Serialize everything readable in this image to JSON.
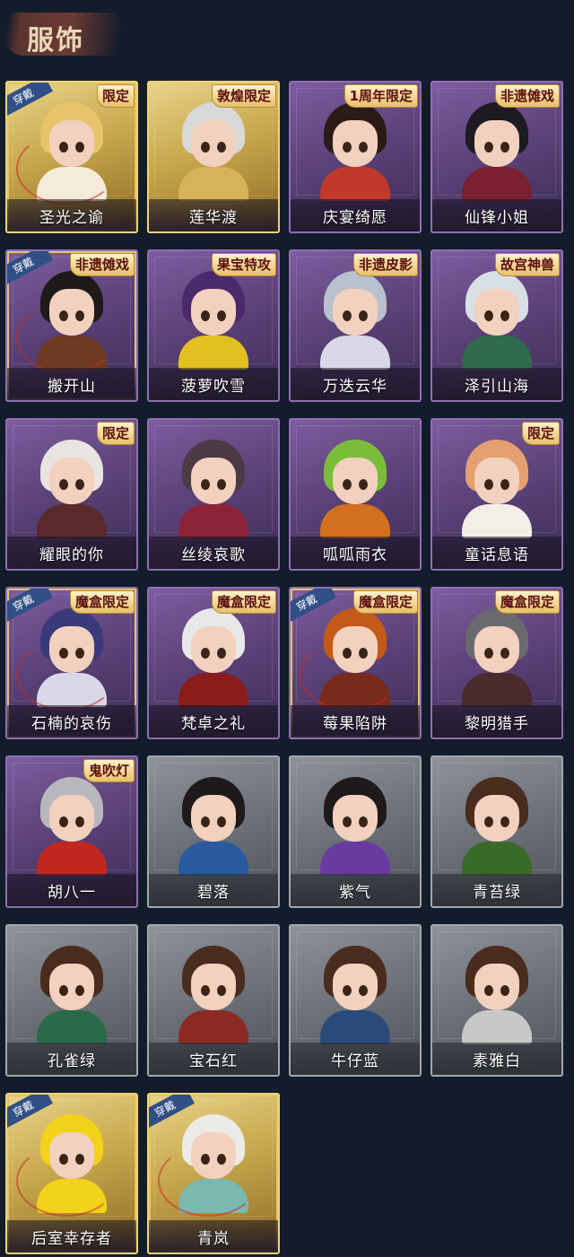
{
  "header": {
    "title": "服饰"
  },
  "cards": [
    {
      "name": "圣光之谕",
      "rarity": "gold",
      "tag": "限定",
      "equipped": true,
      "hair": "#e7c36a",
      "body": "#f4ecd8"
    },
    {
      "name": "莲华渡",
      "rarity": "gold",
      "tag": "敦煌限定",
      "equipped": false,
      "hair": "#d9d9d9",
      "body": "#d8b25a"
    },
    {
      "name": "庆宴绮愿",
      "rarity": "purple",
      "tag": "1周年限定",
      "equipped": false,
      "hair": "#2a1b17",
      "body": "#c0392b"
    },
    {
      "name": "仙锋小姐",
      "rarity": "purple",
      "tag": "非遗傩戏",
      "equipped": false,
      "hair": "#1d1a22",
      "body": "#7a2030"
    },
    {
      "name": "搬开山",
      "rarity": "purple",
      "tag": "非遗傩戏",
      "equipped": true,
      "hair": "#1e1a1a",
      "body": "#6e3a22"
    },
    {
      "name": "菠萝吹雪",
      "rarity": "purple",
      "tag": "果宝特攻",
      "equipped": false,
      "hair": "#4a2a6a",
      "body": "#e2c020"
    },
    {
      "name": "万迭云华",
      "rarity": "purple",
      "tag": "非遗皮影",
      "equipped": false,
      "hair": "#b9c2cc",
      "body": "#d8d8e6"
    },
    {
      "name": "泽引山海",
      "rarity": "purple",
      "tag": "故宫神兽",
      "equipped": false,
      "hair": "#d8e0e6",
      "body": "#2e6b4a"
    },
    {
      "name": "耀眼的你",
      "rarity": "purple",
      "tag": "限定",
      "equipped": false,
      "hair": "#e8e4e0",
      "body": "#5a2a2a"
    },
    {
      "name": "丝绫哀歌",
      "rarity": "purple",
      "tag": "",
      "equipped": false,
      "hair": "#4a3a46",
      "body": "#8a2238"
    },
    {
      "name": "呱呱雨衣",
      "rarity": "purple",
      "tag": "",
      "equipped": false,
      "hair": "#7bbd3a",
      "body": "#d3701f"
    },
    {
      "name": "童话息语",
      "rarity": "purple",
      "tag": "限定",
      "equipped": false,
      "hair": "#e4a070",
      "body": "#f2efe8"
    },
    {
      "name": "石楠的哀伤",
      "rarity": "purple",
      "tag": "魔盒限定",
      "equipped": true,
      "hair": "#3a3a7a",
      "body": "#d8d8e8"
    },
    {
      "name": "梵卓之礼",
      "rarity": "purple",
      "tag": "魔盒限定",
      "equipped": false,
      "hair": "#e8e8ea",
      "body": "#8a1c1c"
    },
    {
      "name": "莓果陷阱",
      "rarity": "purple",
      "tag": "魔盒限定",
      "equipped": true,
      "hair": "#c45a1a",
      "body": "#7a2a1a"
    },
    {
      "name": "黎明猎手",
      "rarity": "purple",
      "tag": "魔盒限定",
      "equipped": false,
      "hair": "#6a6a6e",
      "body": "#4a2a2a"
    },
    {
      "name": "胡八一",
      "rarity": "purple",
      "tag": "鬼吹灯",
      "equipped": false,
      "hair": "#b8b8bc",
      "body": "#c0281e"
    },
    {
      "name": "碧落",
      "rarity": "grey",
      "tag": "",
      "equipped": false,
      "hair": "#1e1a1c",
      "body": "#2a5aa0"
    },
    {
      "name": "紫气",
      "rarity": "grey",
      "tag": "",
      "equipped": false,
      "hair": "#1e1a1c",
      "body": "#6a3aa0"
    },
    {
      "name": "青苔绿",
      "rarity": "grey",
      "tag": "",
      "equipped": false,
      "hair": "#4a2c1e",
      "body": "#3a6a2a"
    },
    {
      "name": "孔雀绿",
      "rarity": "grey",
      "tag": "",
      "equipped": false,
      "hair": "#4a2c1e",
      "body": "#2a6a4a"
    },
    {
      "name": "宝石红",
      "rarity": "grey",
      "tag": "",
      "equipped": false,
      "hair": "#4a2c1e",
      "body": "#8a2a22"
    },
    {
      "name": "牛仔蓝",
      "rarity": "grey",
      "tag": "",
      "equipped": false,
      "hair": "#4a2c1e",
      "body": "#2a4a7a"
    },
    {
      "name": "素雅白",
      "rarity": "grey",
      "tag": "",
      "equipped": false,
      "hair": "#4a2c1e",
      "body": "#c8c8c8"
    },
    {
      "name": "后室幸存者",
      "rarity": "gold",
      "tag": "",
      "equipped": true,
      "hair": "#f2d21a",
      "body": "#f2d21a"
    },
    {
      "name": "青岚",
      "rarity": "gold",
      "tag": "",
      "equipped": true,
      "hair": "#ecebe8",
      "body": "#7ab8b0"
    }
  ],
  "labels": {
    "equipped": "穿戴"
  }
}
